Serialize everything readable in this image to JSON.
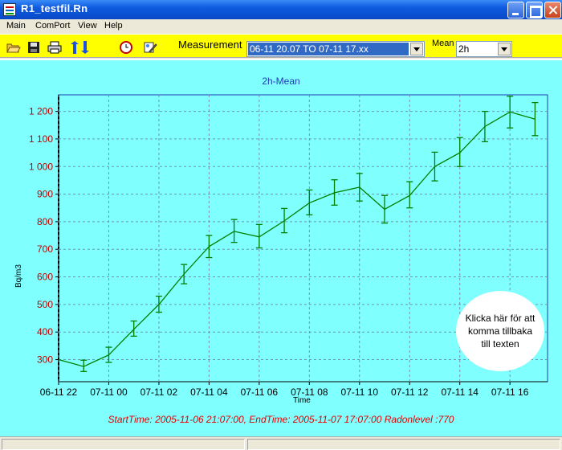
{
  "window": {
    "title": "R1_testfil.Rn"
  },
  "menu": [
    "Main",
    "ComPort",
    "View",
    "Help"
  ],
  "toolbar": {
    "icons": [
      "open-folder-icon",
      "save-disk-icon",
      "print-icon",
      "transfer-arrows-icon",
      "clock-icon",
      "settings-icon"
    ],
    "measurement_label": "Measurement",
    "measurement_value": "06-11 20.07 TO 07-11 17.xx",
    "mean_label": "Mean",
    "mean_value": "2h"
  },
  "chart_data": {
    "type": "line",
    "title": "2h-Mean",
    "xlabel": "Time",
    "ylabel": "Bq/m3",
    "ylim": [
      220,
      1260
    ],
    "yticks": [
      300,
      400,
      500,
      600,
      700,
      800,
      900,
      1000,
      1100,
      1200
    ],
    "ytick_labels": [
      "300",
      "400",
      "500",
      "600",
      "700",
      "800",
      "900",
      "1 000",
      "1 100",
      "1 200"
    ],
    "xlim": [
      0,
      19.5
    ],
    "xticks": [
      0,
      2,
      4,
      6,
      8,
      10,
      12,
      14,
      16,
      18
    ],
    "xtick_labels": [
      "06-11 22",
      "07-11 00",
      "07-11 02",
      "07-11 04",
      "07-11 06",
      "07-11 08",
      "07-11 10",
      "07-11 12",
      "07-11 14",
      "07-11 16"
    ],
    "grid": true,
    "series_color": "#008000",
    "points": [
      {
        "x": 0,
        "y": 300
      },
      {
        "x": 1,
        "y": 275,
        "lo": 257,
        "hi": 298
      },
      {
        "x": 2,
        "y": 317,
        "lo": 290,
        "hi": 345
      },
      {
        "x": 3,
        "y": 410,
        "lo": 385,
        "hi": 440
      },
      {
        "x": 4,
        "y": 500,
        "lo": 472,
        "hi": 530
      },
      {
        "x": 5,
        "y": 610,
        "lo": 575,
        "hi": 645
      },
      {
        "x": 6,
        "y": 710,
        "lo": 670,
        "hi": 750
      },
      {
        "x": 7,
        "y": 765,
        "lo": 725,
        "hi": 808
      },
      {
        "x": 8,
        "y": 745,
        "lo": 705,
        "hi": 790
      },
      {
        "x": 9,
        "y": 803,
        "lo": 760,
        "hi": 848
      },
      {
        "x": 10,
        "y": 868,
        "lo": 825,
        "hi": 915
      },
      {
        "x": 11,
        "y": 905,
        "lo": 860,
        "hi": 952
      },
      {
        "x": 12,
        "y": 925,
        "lo": 875,
        "hi": 975
      },
      {
        "x": 13,
        "y": 845,
        "lo": 795,
        "hi": 895
      },
      {
        "x": 14,
        "y": 895,
        "lo": 850,
        "hi": 945
      },
      {
        "x": 15,
        "y": 1000,
        "lo": 948,
        "hi": 1052
      },
      {
        "x": 16,
        "y": 1050,
        "lo": 1000,
        "hi": 1105
      },
      {
        "x": 17,
        "y": 1145,
        "lo": 1090,
        "hi": 1200
      },
      {
        "x": 18,
        "y": 1198,
        "lo": 1140,
        "hi": 1255
      },
      {
        "x": 19,
        "y": 1172,
        "lo": 1112,
        "hi": 1232
      }
    ]
  },
  "footer": "StartTime: 2005-11-06 21:07:00, EndTime: 2005-11-07 17:07:00 Radonlevel :770",
  "bubble": "Klicka här för att komma tillbaka till texten"
}
